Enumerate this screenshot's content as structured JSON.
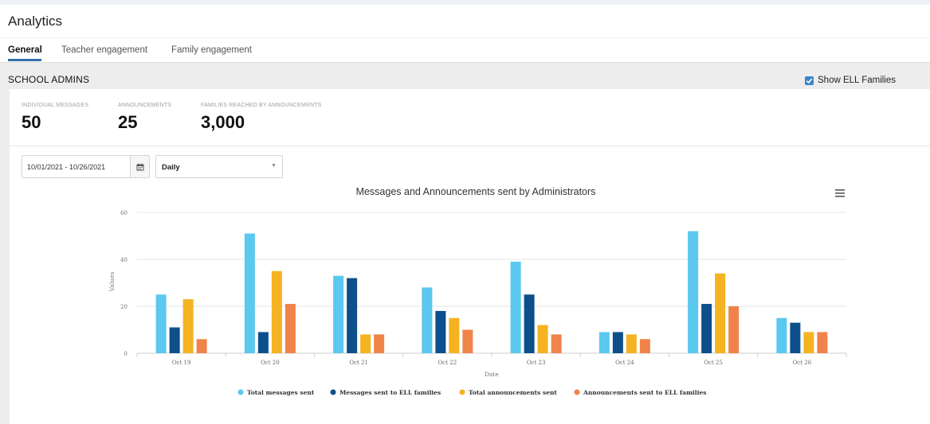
{
  "header": {
    "title": "Analytics"
  },
  "tabs": [
    {
      "label": "General",
      "active": true
    },
    {
      "label": "Teacher engagement",
      "active": false
    },
    {
      "label": "Family engagement",
      "active": false
    }
  ],
  "section": {
    "title": "SCHOOL ADMINS",
    "ell_toggle": {
      "label": "Show ELL Families",
      "checked": true
    }
  },
  "stats": [
    {
      "label": "INDIVIDUAL MESSAGES",
      "value": "50"
    },
    {
      "label": "ANNOUNCEMENTS",
      "value": "25"
    },
    {
      "label": "FAMILIES REACHED BY ANNOUNCEMENTS",
      "value": "3,000"
    }
  ],
  "filters": {
    "date_range": "10/01/2021 - 10/26/2021",
    "interval": "Daily"
  },
  "icons": {
    "calendar": "calendar-icon",
    "menu": "hamburger-menu-icon",
    "checkbox": "checkmark-icon",
    "dropdown": "chevron-down-icon"
  },
  "colors": {
    "accent": "#2f6fa8",
    "series": [
      "#5bc8f0",
      "#0d4f8b",
      "#f5b321",
      "#f0834a"
    ]
  },
  "chart_data": {
    "type": "bar",
    "title": "Messages and Announcements sent by Administrators",
    "xlabel": "Date",
    "ylabel": "Values",
    "ylim": [
      0,
      60
    ],
    "yticks": [
      0,
      20,
      40,
      60
    ],
    "grid": true,
    "legend_position": "bottom",
    "categories": [
      "Oct 19",
      "Oct 20",
      "Oct 21",
      "Oct 22",
      "Oct 23",
      "Oct 24",
      "Oct 25",
      "Oct 26"
    ],
    "series": [
      {
        "name": "Total messages sent",
        "color": "#5bc8f0",
        "values": [
          25,
          51,
          33,
          28,
          39,
          9,
          52,
          15
        ]
      },
      {
        "name": "Messages sent to ELL families",
        "color": "#0d4f8b",
        "values": [
          11,
          9,
          32,
          18,
          25,
          9,
          21,
          13
        ]
      },
      {
        "name": "Total announcements sent",
        "color": "#f5b321",
        "values": [
          23,
          35,
          8,
          15,
          12,
          8,
          34,
          9
        ]
      },
      {
        "name": "Announcements sent to ELL families",
        "color": "#f0834a",
        "values": [
          6,
          21,
          8,
          10,
          8,
          6,
          20,
          9
        ]
      }
    ]
  }
}
